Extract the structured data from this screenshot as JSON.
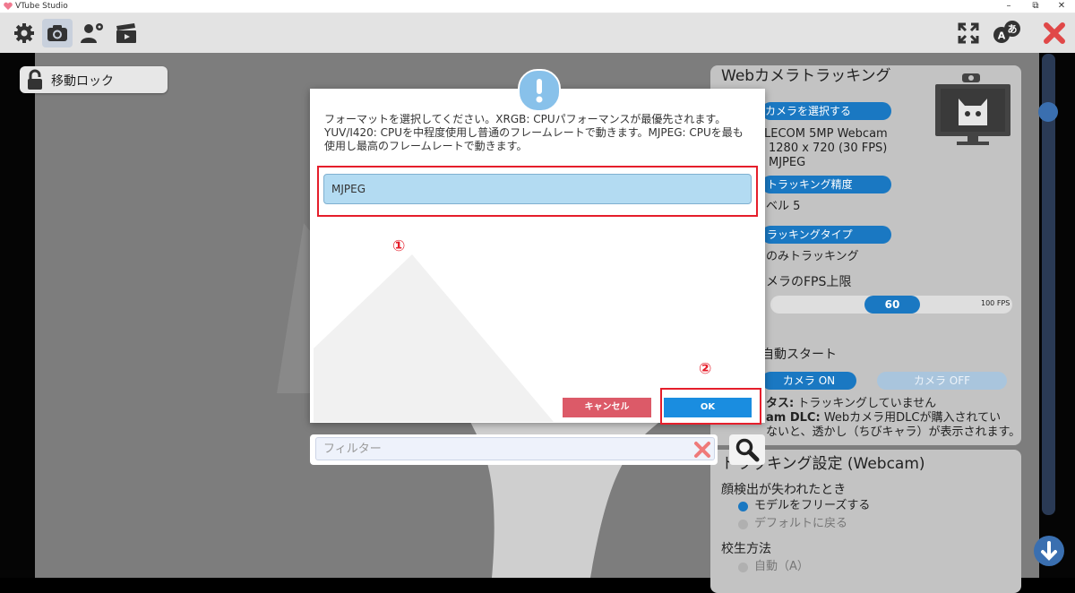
{
  "window": {
    "title": "VTube Studio",
    "minimize": "–",
    "maximize": "⧉",
    "close": "✕"
  },
  "toolbar": {
    "icons": [
      "gear-icon",
      "camera-icon",
      "user-settings-icon",
      "clapperboard-icon",
      "fullscreen-icon",
      "language-icon",
      "close-app-icon"
    ],
    "language_glyph_a": "A",
    "language_glyph_b": "あ"
  },
  "lock_panel": {
    "label": "移動ロック"
  },
  "webcam_panel": {
    "title": "Webカメラトラッキング",
    "select_camera": "カメラを選択する",
    "camera_name": "LECOM 5MP Webcam",
    "resolution": "1280 x 720 (30 FPS)",
    "format": "MJPEG",
    "tracking_accuracy": "トラッキング精度",
    "accuracy_value": "ベル 5",
    "tracking_type": "ラッキングタイプ",
    "tracking_type_value": "のみトラッキング",
    "fps_limit": "メラのFPS上限",
    "fps_value": "60",
    "fps_max": "100 FPS",
    "auto_start": "自動スタート",
    "camera_on": "カメラ ON",
    "camera_off": "カメラ OFF",
    "status_label": "タス:",
    "status_value": "トラッキングしていません",
    "dlc_label": "am DLC:",
    "dlc_value": "Webカメラ用DLCが購入されてい",
    "dlc_value2": "ないと、透かし（ちびキャラ）が表示されます。"
  },
  "tracking_settings": {
    "title": "トラッキング設定 (Webcam)",
    "face_lost": "顔検出が失われたとき",
    "option_freeze": "モデルをフリーズする",
    "option_default": "デフォルトに戻る",
    "calibration": "校生方法",
    "calibration_auto": "自動（A）"
  },
  "dialog": {
    "message": "フォーマットを選択してください。XRGB: CPUパフォーマンスが最優先されます。YUV/I420: CPUを中程度使用し普通のフレームレートで動きます。MJPEG: CPUを最も使用し最高のフレームレートで動きます。",
    "selected_format": "MJPEG",
    "cancel_label": "キャンセル",
    "ok_label": "OK"
  },
  "annotations": {
    "marker_1": "①",
    "marker_2": "②",
    "highlight_color": "#e51e2b"
  },
  "filter": {
    "placeholder": "フィルター"
  },
  "colors": {
    "accent_blue": "#1a78c2",
    "ok_blue": "#1a8de0",
    "cancel_red": "#dc5a68",
    "selection_blue": "#b3dbf2"
  }
}
